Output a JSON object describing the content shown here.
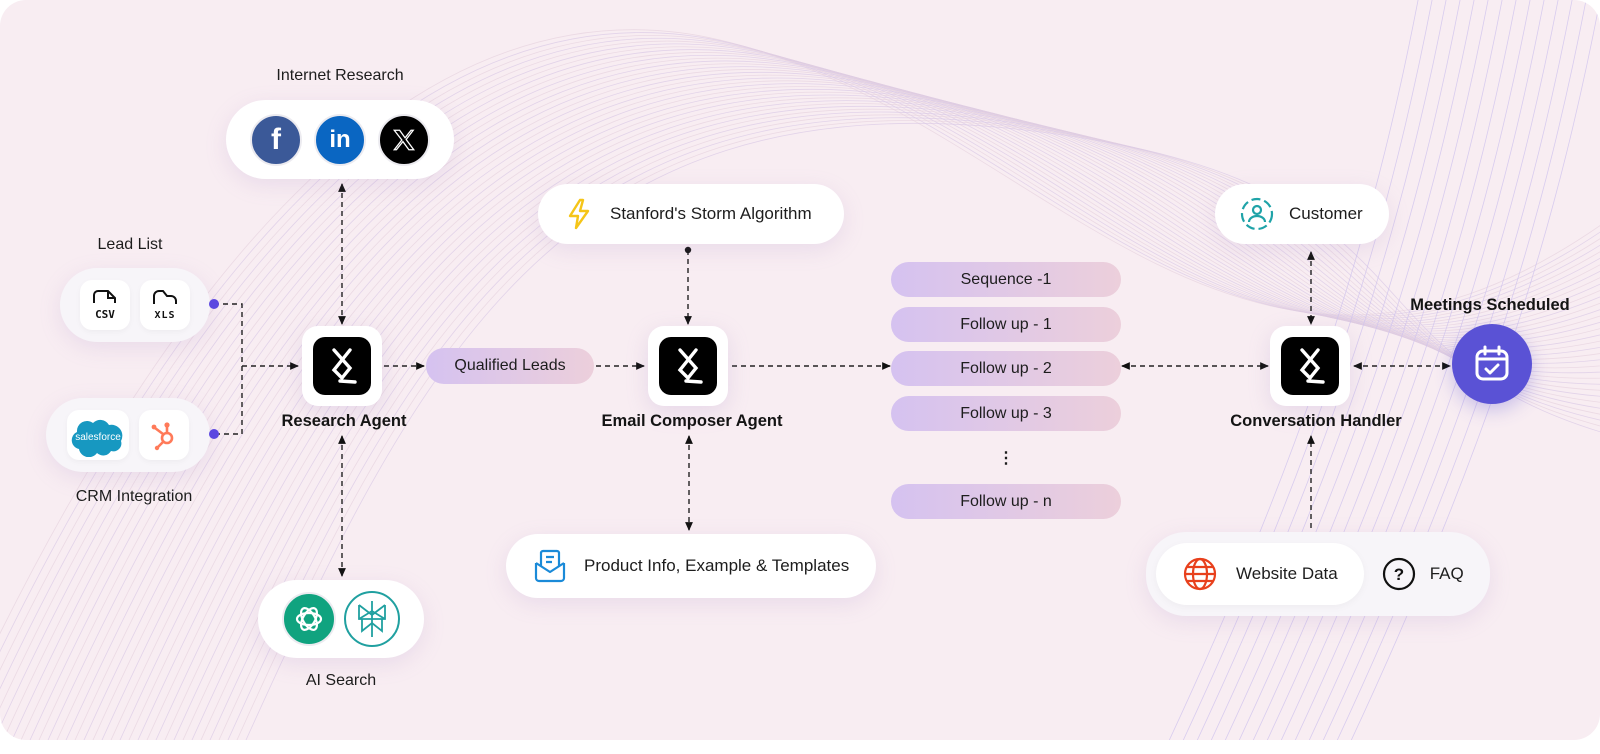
{
  "diagram": {
    "lead_list": {
      "label": "Lead List",
      "items": [
        {
          "name": "CSV",
          "icon": "csv-file-icon"
        },
        {
          "name": "XLS",
          "icon": "xls-file-icon"
        }
      ]
    },
    "crm_integration": {
      "label": "CRM Integration",
      "items": [
        {
          "name": "salesforce",
          "icon": "salesforce-icon"
        },
        {
          "name": "HubSpot",
          "icon": "hubspot-icon"
        }
      ]
    },
    "internet_research": {
      "label": "Internet Research",
      "items": [
        {
          "name": "Facebook",
          "icon": "facebook-icon",
          "color": "#3b5998"
        },
        {
          "name": "LinkedIn",
          "icon": "linkedin-icon",
          "color": "#0a66c2"
        },
        {
          "name": "X",
          "icon": "x-icon",
          "color": "#000000"
        }
      ]
    },
    "ai_search": {
      "label": "AI Search",
      "items": [
        {
          "name": "ChatGPT",
          "icon": "openai-icon",
          "color": "#10a37f"
        },
        {
          "name": "Perplexity",
          "icon": "perplexity-icon",
          "color": "#20a0a0"
        }
      ]
    },
    "research_agent": {
      "label": "Research Agent"
    },
    "qualified_leads": {
      "label": "Qualified Leads"
    },
    "storm": {
      "label": "Stanford's Storm Algorithm",
      "icon": "lightning-icon",
      "color": "#f5c518"
    },
    "email_composer_agent": {
      "label": "Email Composer Agent"
    },
    "product_info": {
      "label": "Product Info, Example & Templates",
      "icon": "mail-open-icon",
      "color": "#1a8ad8"
    },
    "sequence": {
      "items": [
        "Sequence -1",
        "Follow up - 1",
        "Follow up - 2",
        "Follow up - 3",
        "Follow up - n"
      ],
      "ellipsis": "⋮"
    },
    "customer": {
      "label": "Customer",
      "icon": "user-circle-icon",
      "color": "#1fa3a8"
    },
    "conversation_handler": {
      "label": "Conversation Handler"
    },
    "meetings": {
      "label": "Meetings Scheduled",
      "icon": "calendar-check-icon",
      "color": "#5a52d5"
    },
    "knowledge": {
      "items": [
        {
          "label": "Website Data",
          "icon": "globe-icon",
          "color": "#e8401c"
        },
        {
          "label": "FAQ",
          "icon": "question-icon",
          "color": "#111111"
        }
      ]
    },
    "file_labels": {
      "csv": "CSV",
      "xls": "XLS",
      "salesforce": "salesforce",
      "facebook": "f",
      "linkedin": "in"
    }
  }
}
